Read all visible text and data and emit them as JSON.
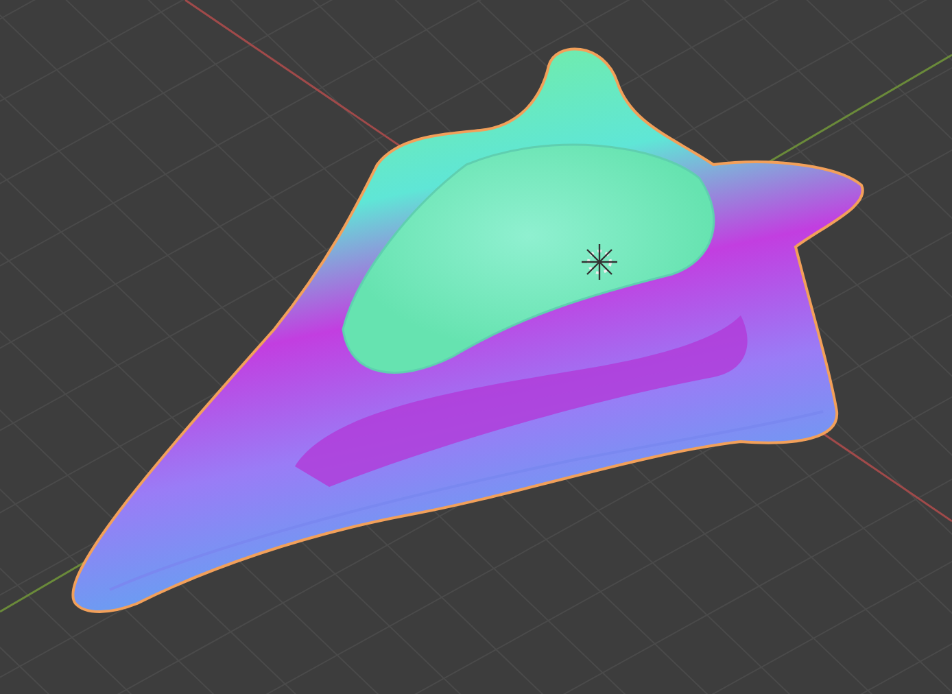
{
  "viewport": {
    "show_grid": true,
    "show_axes": true,
    "object_selected": true,
    "show_cursor": true
  }
}
